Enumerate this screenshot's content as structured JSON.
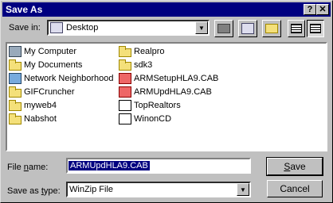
{
  "title": "Save As",
  "title_buttons": {
    "help": "?",
    "close": "✕"
  },
  "save_in": {
    "label": "Save in:",
    "value": "Desktop"
  },
  "files": [
    {
      "name": "My Computer",
      "icon": "computer-icon"
    },
    {
      "name": "My Documents",
      "icon": "documents-folder-icon"
    },
    {
      "name": "Network Neighborhood",
      "icon": "network-icon"
    },
    {
      "name": "GIFCruncher",
      "icon": "folder-icon"
    },
    {
      "name": "myweb4",
      "icon": "folder-icon"
    },
    {
      "name": "Nabshot",
      "icon": "folder-icon"
    },
    {
      "name": "Realpro",
      "icon": "folder-icon"
    },
    {
      "name": "sdk3",
      "icon": "folder-icon"
    },
    {
      "name": "ARMSetupHLA9.CAB",
      "icon": "cab-file-icon"
    },
    {
      "name": "ARMUpdHLA9.CAB",
      "icon": "cab-file-icon"
    },
    {
      "name": "TopRealtors",
      "icon": "shortcut-icon"
    },
    {
      "name": "WinonCD",
      "icon": "shortcut-icon"
    }
  ],
  "file_name": {
    "label": "File name:",
    "value": "ARMUpdHLA9.CAB"
  },
  "save_as_type": {
    "label": "Save as type:",
    "value": "WinZip File"
  },
  "buttons": {
    "save": "Save",
    "cancel": "Cancel"
  },
  "colors": {
    "title_bar": "#000080",
    "face": "#c0c0c0",
    "selection": "#000080",
    "folder": "#f4e07a"
  }
}
